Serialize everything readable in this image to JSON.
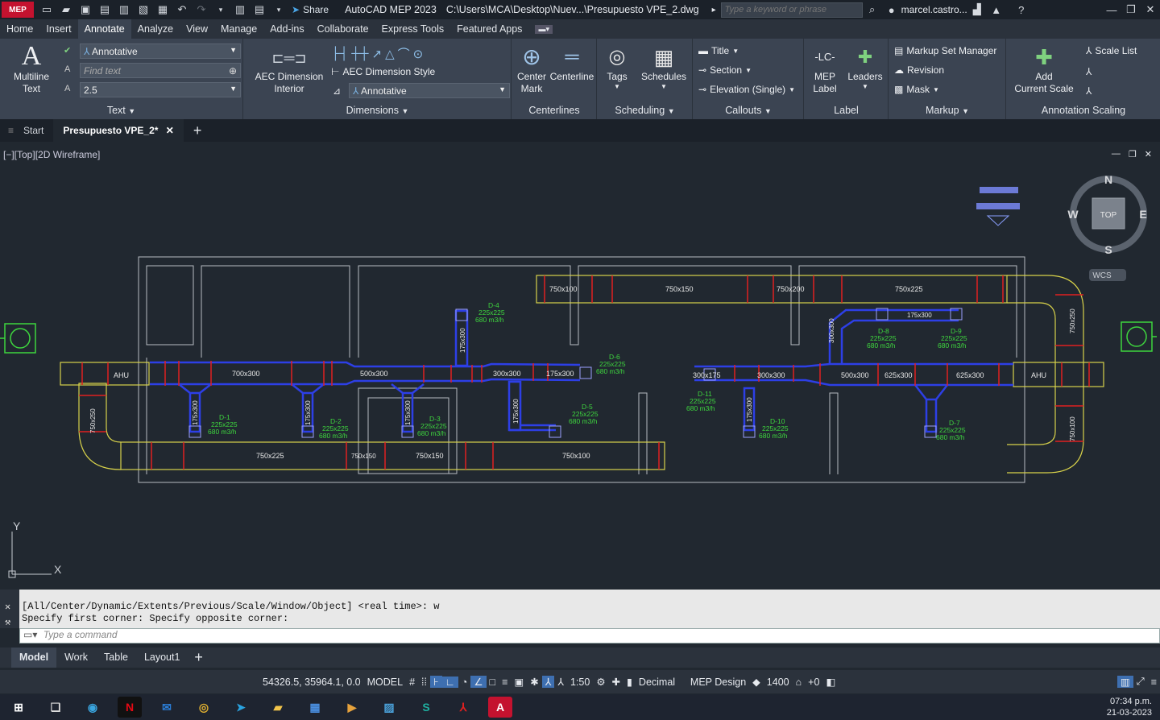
{
  "app": {
    "badge": "MEP",
    "title": "AutoCAD MEP 2023",
    "file_path": "C:\\Users\\MCA\\Desktop\\Nuev...\\Presupuesto VPE_2.dwg",
    "search_placeholder": "Type a keyword or phrase",
    "user": "marcel.castro...",
    "share_label": "Share"
  },
  "menu": [
    "Home",
    "Insert",
    "Annotate",
    "Analyze",
    "View",
    "Manage",
    "Add-ins",
    "Collaborate",
    "Express Tools",
    "Featured Apps"
  ],
  "ribbon": {
    "text_panel": {
      "label": "Text",
      "multiline": "Multiline",
      "multiline2": "Text",
      "style": "Annotative",
      "find_placeholder": "Find text",
      "height": "2.5"
    },
    "dim_panel": {
      "label": "Dimensions",
      "aec_dim": "AEC Dimension",
      "aec_dim2": "Interior",
      "aec_style": "AEC Dimension Style",
      "style_value": "Annotative"
    },
    "center_panel": {
      "label": "Centerlines",
      "center_mark": "Center",
      "center_mark2": "Mark",
      "centerline": "Centerline"
    },
    "sched_panel": {
      "label": "Scheduling",
      "tags": "Tags",
      "schedules": "Schedules"
    },
    "callouts_panel": {
      "label": "Callouts",
      "title": "Title",
      "section": "Section",
      "elevation": "Elevation (Single)"
    },
    "label_panel": {
      "label": "Label",
      "mep": "MEP",
      "mep2": "Label",
      "leaders": "Leaders"
    },
    "markup_panel": {
      "label": "Markup",
      "manager": "Markup Set Manager",
      "revision": "Revision",
      "mask": "Mask"
    },
    "scaling_panel": {
      "label": "Annotation Scaling",
      "add": "Add",
      "add2": "Current Scale",
      "scale_list": "Scale List"
    }
  },
  "tabs": {
    "start": "Start",
    "doc": "Presupuesto VPE_2*"
  },
  "viewport": {
    "label": "[−][Top][2D Wireframe]",
    "compass": {
      "n": "N",
      "s": "S",
      "e": "E",
      "w": "W",
      "top": "TOP",
      "wcs": "WCS"
    },
    "ucs_x": "X",
    "ucs_y": "Y"
  },
  "drawing": {
    "duct_labels_top": [
      "750x100",
      "750x150",
      "750x200",
      "750x225"
    ],
    "duct_labels_mid": [
      "700x300",
      "500x300",
      "300x300",
      "175x300",
      "300x175",
      "300x300",
      "500x300",
      "625x300",
      "625x300"
    ],
    "duct_labels_bottom": [
      "750x225",
      "750x150",
      "750x100",
      "750x150"
    ],
    "ahu": "AHU",
    "branch_a": "175x300",
    "branch_b": "175x300",
    "branch_c": "175x300",
    "branch_d": "175x300",
    "branch_e": "300x300",
    "branch_f": "175x300",
    "branch_g": "175x300",
    "diffusers": [
      {
        "id": "D-1",
        "size": "225x225",
        "flow": "680 m3/h"
      },
      {
        "id": "D-2",
        "size": "225x225",
        "flow": "680 m3/h"
      },
      {
        "id": "D-3",
        "size": "225x225",
        "flow": "680 m3/h"
      },
      {
        "id": "D-4",
        "size": "225x225",
        "flow": "680 m3/h"
      },
      {
        "id": "D-5",
        "size": "225x225",
        "flow": "680 m3/h"
      },
      {
        "id": "D-6",
        "size": "225x225",
        "flow": "680 m3/h"
      },
      {
        "id": "D-7",
        "size": "225x225",
        "flow": "680 m3/h"
      },
      {
        "id": "D-8",
        "size": "225x225",
        "flow": "680 m3/h"
      },
      {
        "id": "D-9",
        "size": "225x225",
        "flow": "680 m3/h"
      },
      {
        "id": "D-10",
        "size": "225x225",
        "flow": "680 m3/h"
      },
      {
        "id": "D-11",
        "size": "225x225",
        "flow": "680 m3/h"
      }
    ],
    "side_left": "750x250",
    "side_right_top": "750x250",
    "side_right_bottom": "750x100",
    "branch_175x300_right": "175x300"
  },
  "command": {
    "line1": "[All/Center/Dynamic/Extents/Previous/Scale/Window/Object] <real time>: w",
    "line2": "Specify first corner: Specify opposite corner:",
    "placeholder": "Type a command"
  },
  "layouts": [
    "Model",
    "Work",
    "Table",
    "Layout1"
  ],
  "status": {
    "coords": "54326.5, 35964.1, 0.0",
    "mode": "MODEL",
    "scale": "1:50",
    "units": "Decimal",
    "workspace": "MEP Design",
    "elev": "1400",
    "plus": "+0"
  },
  "clock": {
    "time": "07:34 p.m.",
    "date": "21-03-2023"
  }
}
